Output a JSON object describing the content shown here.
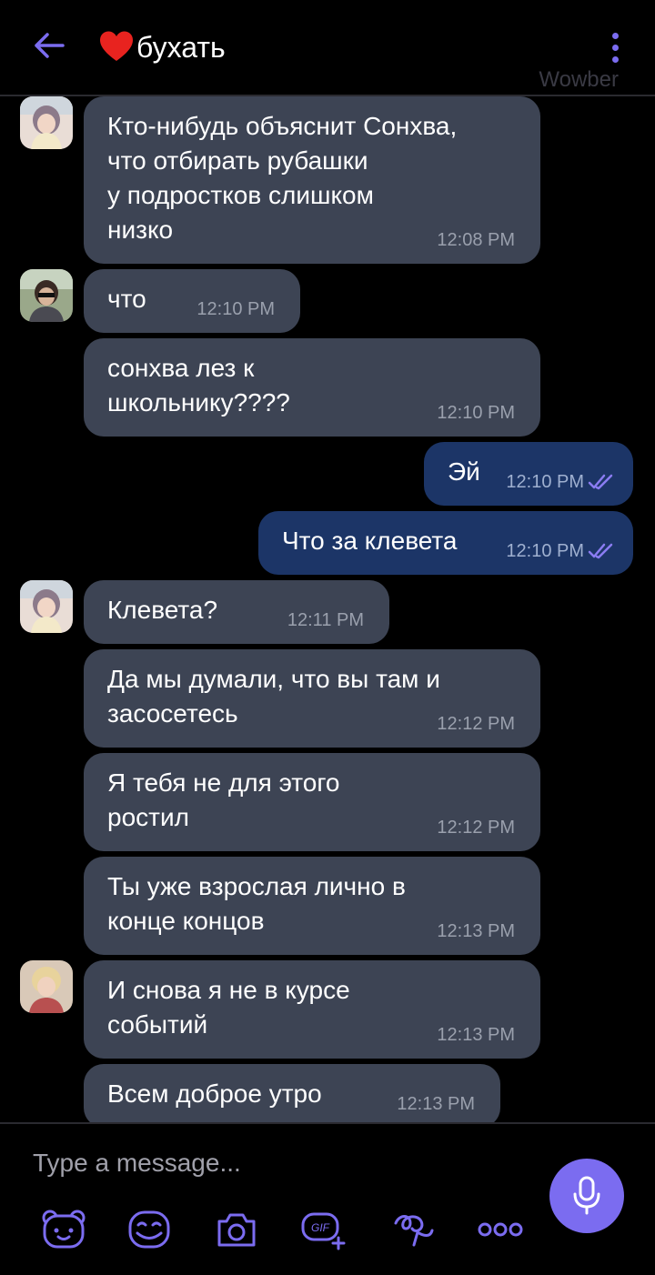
{
  "header": {
    "title": "бухать",
    "watermark": "Wowber"
  },
  "colors": {
    "accent": "#7b6cf0",
    "incoming_bubble": "#3d4454",
    "outgoing_bubble": "#1c3567",
    "background": "#000000"
  },
  "messages": [
    {
      "direction": "in",
      "text": "Кто-нибудь объяснит Сонхва,\nчто отбирать рубашки\nу подростков слишком\nнизко",
      "time": "12:08 PM"
    },
    {
      "direction": "in",
      "text": "что",
      "time": "12:10 PM"
    },
    {
      "direction": "in",
      "text": "сонхва лез к\nшкольнику????",
      "time": "12:10 PM"
    },
    {
      "direction": "out",
      "text": "Эй",
      "time": "12:10 PM",
      "status": "read-double-check-icon"
    },
    {
      "direction": "out",
      "text": "Что за клевета",
      "time": "12:10 PM",
      "status": "read-double-check-icon"
    },
    {
      "direction": "in",
      "text": "Клевета?",
      "time": "12:11 PM"
    },
    {
      "direction": "in",
      "text": "Да мы думали, что вы там и\nзасосетесь",
      "time": "12:12 PM"
    },
    {
      "direction": "in",
      "text": "Я тебя не для этого\nростил",
      "time": "12:12 PM"
    },
    {
      "direction": "in",
      "text": "Ты уже взрослая лично в\nконце концов",
      "time": "12:13 PM"
    },
    {
      "direction": "in",
      "text": "И снова я не в курсе\nсобытий",
      "time": "12:13 PM"
    },
    {
      "direction": "in",
      "text": "Всем доброе утро",
      "time": "12:13 PM"
    }
  ],
  "composer": {
    "placeholder": "Type a message...",
    "toolbar": [
      "sticker-bear-icon",
      "emoji-icon",
      "camera-icon",
      "gif-icon",
      "doodle-icon",
      "more-icon"
    ],
    "mic": "microphone-icon"
  }
}
